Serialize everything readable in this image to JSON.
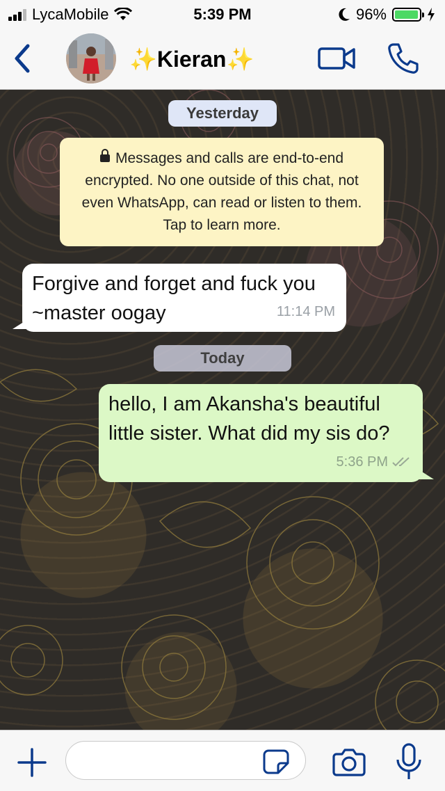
{
  "status_bar": {
    "carrier": "LycaMobile",
    "time": "5:39 PM",
    "battery_percent": "96%",
    "battery_level": 0.96,
    "signal_bars": 3
  },
  "header": {
    "contact_name": "✨Kieran✨",
    "back_icon": "chevron-left-icon",
    "video_icon": "video-camera-icon",
    "call_icon": "phone-icon"
  },
  "chat": {
    "date_yesterday": "Yesterday",
    "date_today": "Today",
    "encryption_note": "Messages and calls are end-to-end encrypted. No one outside of this chat, not even WhatsApp, can read or listen to them. Tap to learn more.",
    "messages": [
      {
        "direction": "incoming",
        "text": "Forgive and forget and fuck you  ~master oogay",
        "time": "11:14 PM"
      },
      {
        "direction": "outgoing",
        "text": "hello, I am Akansha's beautiful little sister. What did my sis do?",
        "time": "5:36 PM",
        "status": "delivered"
      }
    ]
  },
  "input_bar": {
    "message_value": "",
    "plus_icon": "plus-icon",
    "sticker_icon": "sticker-icon",
    "camera_icon": "camera-icon",
    "mic_icon": "microphone-icon"
  },
  "colors": {
    "accent": "#0b3a8c",
    "outgoing_bubble": "#dcf8c6",
    "incoming_bubble": "#ffffff",
    "system_note": "#fdf4c5",
    "battery_fill": "#4cd964"
  }
}
